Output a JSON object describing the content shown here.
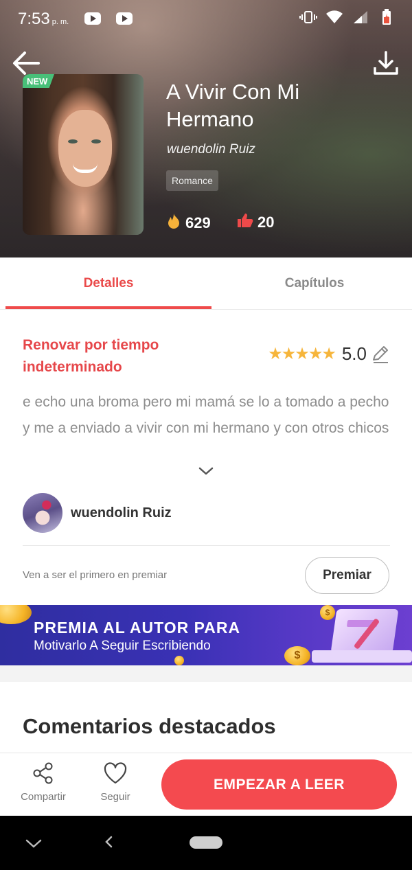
{
  "status_bar": {
    "time": "7:53",
    "ampm": "p. m."
  },
  "book": {
    "badge": "NEW",
    "title": "A Vivir Con Mi Hermano",
    "author": "wuendolin Ruiz",
    "genre": "Romance",
    "reads": "629",
    "likes": "20"
  },
  "tabs": [
    {
      "label": "Detalles",
      "active": true
    },
    {
      "label": "Capítulos",
      "active": false
    }
  ],
  "details": {
    "update_status": "Renovar por tiempo indeterminado",
    "rating": "5.0",
    "star_count": 5,
    "description": "e echo una broma pero mi mamá se lo a tomado a pecho y me a enviado a vivir con mi hermano y con otros chicos",
    "author_name": "wuendolin Ruiz",
    "premiar_prompt": "Ven a ser el primero en premiar",
    "premiar_button": "Premiar"
  },
  "banner": {
    "title": "PREMIA AL AUTOR PARA",
    "subtitle": "Motivarlo A Seguir Escribiendo",
    "coin_symbol": "$"
  },
  "comments": {
    "title": "Comentarios destacados"
  },
  "bottom_bar": {
    "share_label": "Compartir",
    "follow_label": "Seguir",
    "read_button": "EMPEZAR A LEER"
  },
  "colors": {
    "accent": "#ef4b4b",
    "star": "#f6b53b",
    "badge_green": "#48c079",
    "banner_blue": "#3a31b5"
  },
  "icons": {
    "back": "arrow-left-icon",
    "download": "download-icon",
    "reads": "fire-icon",
    "likes": "thumbs-up-icon",
    "edit": "pencil-icon",
    "expand": "chevron-down-icon",
    "share": "share-icon",
    "follow": "heart-icon"
  }
}
